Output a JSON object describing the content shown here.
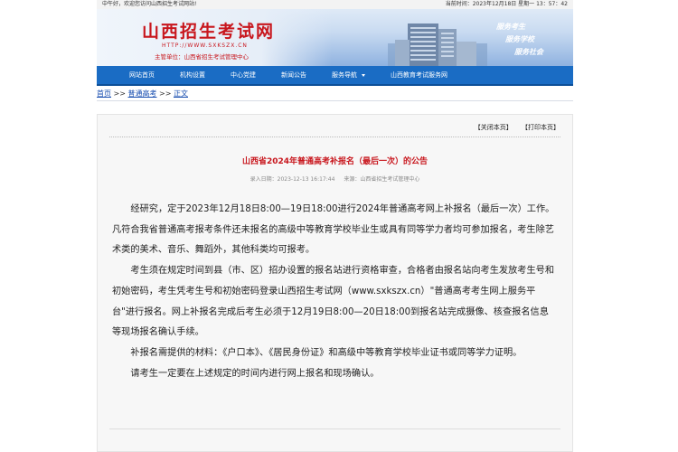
{
  "topbar": {
    "welcome": "中午好，欢迎您访问山西招生考试网站!",
    "clock": "当前时间：2023年12月18日 星期一 13：57：42"
  },
  "banner": {
    "site_title": "山西招生考试网",
    "site_url": "HTTP://WWW.SXKSZX.CN",
    "sponsor": "主管单位：山西省招生考试管理中心",
    "slogans": [
      "服务考生",
      "服务学校",
      "服务社会"
    ]
  },
  "nav": {
    "items": [
      "网站首页",
      "机构设置",
      "中心党建",
      "新闻公告",
      "服务导航",
      "山西教育考试服务网"
    ]
  },
  "breadcrumb": {
    "home": "首页",
    "sep": ">>",
    "section": "普通高考",
    "current": "正文"
  },
  "tools": {
    "close": "【关闭本页】",
    "print": "【打印本页】"
  },
  "article": {
    "title": "山西省2024年普通高考补报名（最后一次）的公告",
    "date": "录入日期：2023-12-13 16:17:44",
    "source": "来源：山西省招生考试管理中心",
    "paragraphs": [
      "经研究，定于2023年12月18日8:00—19日18:00进行2024年普通高考网上补报名（最后一次）工作。凡符合我省普通高考报考条件还未报名的高级中等教育学校毕业生或具有同等学力者均可参加报名，考生除艺术类的美术、音乐、舞蹈外，其他科类均可报考。",
      "考生须在规定时间到县（市、区）招办设置的报名站进行资格审查，合格者由报名站向考生发放考生号和初始密码，考生凭考生号和初始密码登录山西招生考试网（www.sxkszx.cn）\"普通高考考生网上服务平台\"进行报名。网上补报名完成后考生必须于12月19日8:00—20日18:00到报名站完成摄像、核查报名信息等现场报名确认手续。",
      "补报名需提供的材料：《户口本》、《居民身份证》和高级中等教育学校毕业证书或同等学力证明。",
      "请考生一定要在上述规定的时间内进行网上报名和现场确认。"
    ]
  }
}
